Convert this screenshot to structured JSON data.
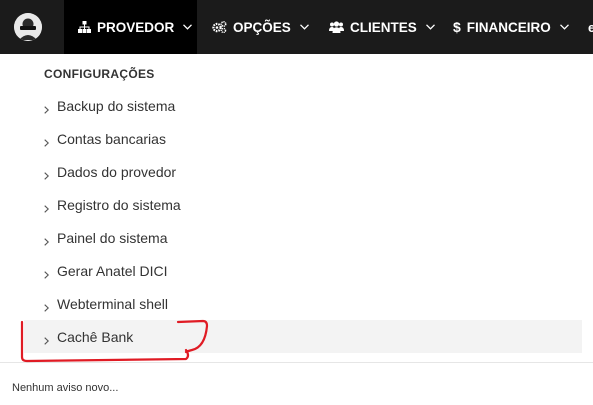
{
  "navbar": {
    "items": [
      {
        "label": "PROVEDOR",
        "icon": "sitemap-icon"
      },
      {
        "label": "OPÇÕES",
        "icon": "cogs-icon"
      },
      {
        "label": "CLIENTES",
        "icon": "users-icon"
      },
      {
        "label": "FINANCEIRO",
        "icon": "dollar-icon"
      }
    ],
    "active_index": 0,
    "active_bg": "#000000",
    "bar_bg": "#1b1b1b"
  },
  "dropdown": {
    "section_title": "CONFIGURAÇÕES",
    "items": [
      {
        "label": "Backup do sistema"
      },
      {
        "label": "Contas bancarias"
      },
      {
        "label": "Dados do provedor"
      },
      {
        "label": "Registro do sistema"
      },
      {
        "label": "Painel do sistema"
      },
      {
        "label": "Gerar Anatel DICI"
      },
      {
        "label": "Webterminal shell"
      },
      {
        "label": "Cachê Bank"
      }
    ],
    "highlighted_index": 7
  },
  "notifications": {
    "text": "Nenhum aviso novo..."
  },
  "annotation_color": "#e01b24"
}
